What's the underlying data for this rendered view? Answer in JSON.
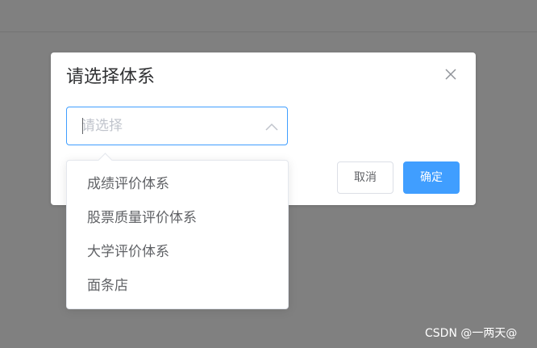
{
  "dialog": {
    "title": "请选择体系",
    "select": {
      "placeholder": "请选择",
      "value": ""
    },
    "buttons": {
      "cancel": "取消",
      "ok": "确定"
    }
  },
  "dropdown": {
    "options": [
      "成绩评价体系",
      "股票质量评价体系",
      "大学评价体系",
      "面条店"
    ]
  },
  "watermark": "CSDN @一两天@",
  "colors": {
    "overlay": "#808080",
    "accent": "#409eff",
    "text": "#606266",
    "placeholder": "#c0c4cc"
  },
  "icons": {
    "close": "close-icon",
    "arrow": "chevron-up-icon"
  }
}
